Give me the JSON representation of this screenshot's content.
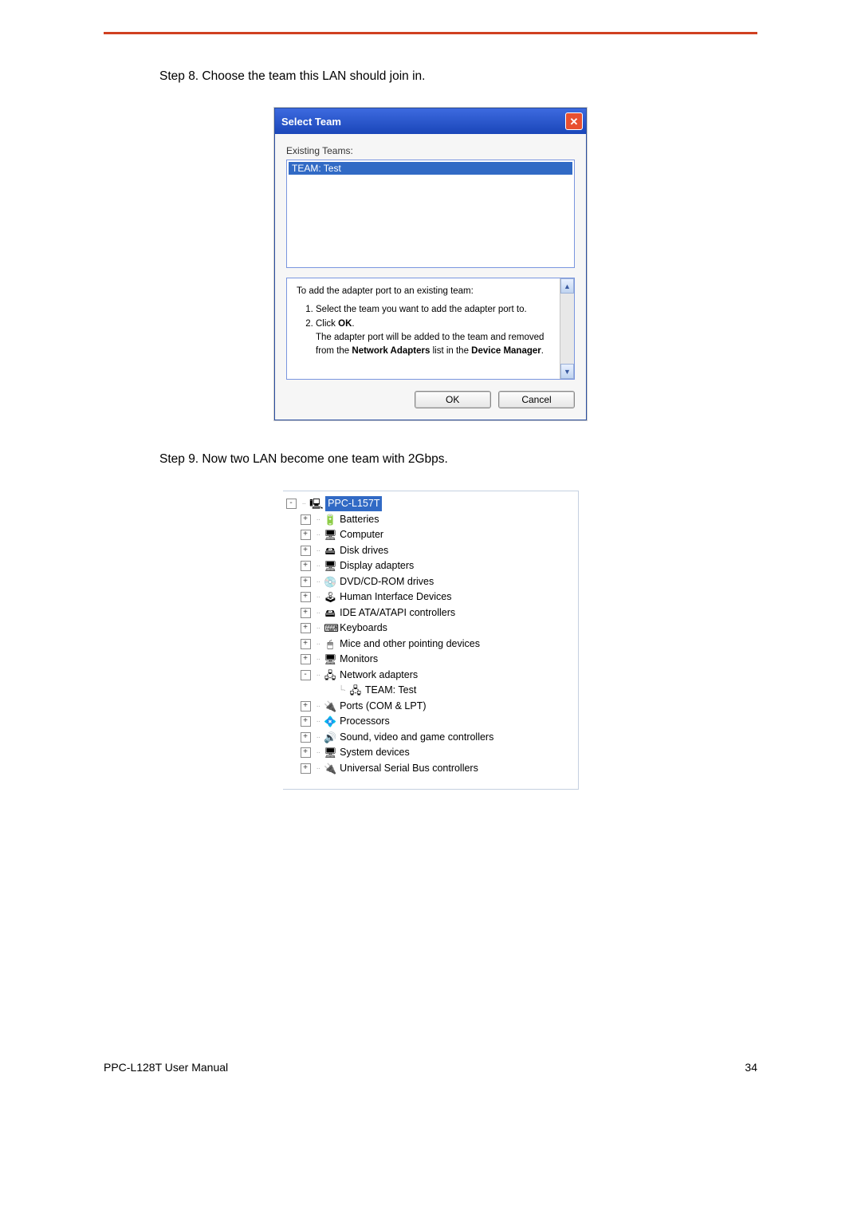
{
  "step8": "Step 8. Choose the team this LAN should join in.",
  "step9": "Step 9. Now two LAN become one team with 2Gbps.",
  "dialog": {
    "title": "Select Team",
    "existing_label": "Existing Teams:",
    "selected_team": "TEAM: Test",
    "info_intro": "To add the adapter port to an existing team:",
    "info_li1": "Select the team you want to add the adapter port to.",
    "info_li2a": "Click ",
    "info_li2b": "OK",
    "info_li2c": ".",
    "info_li2_cont1": "The adapter port will be added to the team and removed from the ",
    "info_li2_cont2": "Network Adapters",
    "info_li2_cont3": " list in the ",
    "info_li2_cont4": "Device Manager",
    "info_li2_cont5": ".",
    "ok": "OK",
    "cancel": "Cancel"
  },
  "tree": {
    "root": "PPC-L157T",
    "items": [
      {
        "pm": "+",
        "icon": "🔋",
        "label": "Batteries"
      },
      {
        "pm": "+",
        "icon": "🖥",
        "label": "Computer"
      },
      {
        "pm": "+",
        "icon": "🖴",
        "label": "Disk drives"
      },
      {
        "pm": "+",
        "icon": "🖥",
        "label": "Display adapters"
      },
      {
        "pm": "+",
        "icon": "💿",
        "label": "DVD/CD-ROM drives"
      },
      {
        "pm": "+",
        "icon": "🕹",
        "label": "Human Interface Devices"
      },
      {
        "pm": "+",
        "icon": "🖴",
        "label": "IDE ATA/ATAPI controllers"
      },
      {
        "pm": "+",
        "icon": "⌨",
        "label": "Keyboards"
      },
      {
        "pm": "+",
        "icon": "🖱",
        "label": "Mice and other pointing devices"
      },
      {
        "pm": "+",
        "icon": "🖥",
        "label": "Monitors"
      },
      {
        "pm": "-",
        "icon": "🖧",
        "label": "Network adapters"
      },
      {
        "pm": "",
        "icon": "🖧",
        "label": "TEAM: Test",
        "child": true
      },
      {
        "pm": "+",
        "icon": "🔌",
        "label": "Ports (COM & LPT)"
      },
      {
        "pm": "+",
        "icon": "💠",
        "label": "Processors"
      },
      {
        "pm": "+",
        "icon": "🔊",
        "label": "Sound, video and game controllers"
      },
      {
        "pm": "+",
        "icon": "🖥",
        "label": "System devices"
      },
      {
        "pm": "+",
        "icon": "🔌",
        "label": "Universal Serial Bus controllers"
      }
    ]
  },
  "footer": {
    "left": "PPC-L128T User Manual",
    "right": "34"
  }
}
